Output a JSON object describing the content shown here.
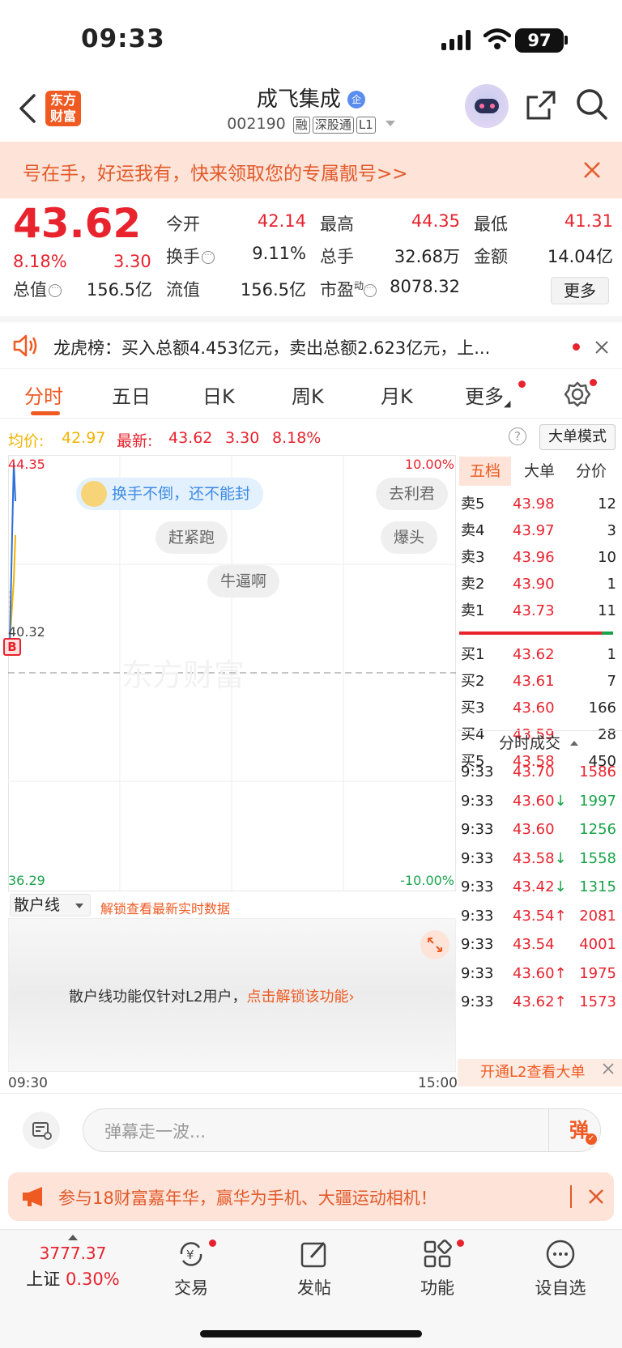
{
  "status_bar": {
    "time": "09:33",
    "battery": "97"
  },
  "header": {
    "logo_line1": "东方",
    "logo_line2": "财富",
    "stock_name": "成飞集成",
    "stock_badge": "企",
    "stock_code": "002190",
    "tags": [
      "融",
      "深股通",
      "L1"
    ]
  },
  "promo": {
    "text": "号在手，好运我有，快来领取您的专属靓号>>"
  },
  "quote": {
    "price": "43.62",
    "change_pct": "8.18%",
    "change": "3.30",
    "fields": [
      {
        "label": "今开",
        "value": "42.14",
        "color": "red"
      },
      {
        "label": "最高",
        "value": "44.35",
        "color": "red"
      },
      {
        "label": "最低",
        "value": "41.31",
        "color": "red"
      },
      {
        "label": "换手",
        "value": "9.11%",
        "color": "dark"
      },
      {
        "label": "总手",
        "value": "32.68万",
        "color": "dark"
      },
      {
        "label": "金额",
        "value": "14.04亿",
        "color": "dark"
      },
      {
        "label": "总值",
        "value": "156.5亿",
        "color": "dark"
      },
      {
        "label": "流值",
        "value": "156.5亿",
        "color": "dark"
      },
      {
        "label": "市盈",
        "value": "8078.32",
        "color": "dark"
      }
    ],
    "pe_superscript": "动",
    "more_label": "更多"
  },
  "dragon_tiger": {
    "text": "龙虎榜：买入总额4.453亿元，卖出总额2.623亿元，上..."
  },
  "tabs": [
    "分时",
    "五日",
    "日K",
    "周K",
    "月K",
    "更多"
  ],
  "info_line": {
    "avg_label": "均价:",
    "avg_value": "42.97",
    "latest_label": "最新:",
    "latest_value": "43.62",
    "change": "3.30",
    "change_pct": "8.18%",
    "big_order_mode": "大单模式"
  },
  "chart_data": {
    "type": "line",
    "y_high": "44.35",
    "y_low": "36.29",
    "y_prev_close": "40.32",
    "pct_high": "10.00%",
    "pct_low": "-10.00%",
    "x_start": "09:30",
    "x_end": "15:00",
    "watermark": "东方财富",
    "series": [
      {
        "values": [
          40.9,
          44.35,
          43.62
        ]
      },
      {
        "values": [
          40.9,
          42.1,
          42.97
        ]
      }
    ],
    "buy_marker": "B"
  },
  "danmaku": [
    "换手不倒，还不能封",
    "去利君",
    "赶紧跑",
    "爆头",
    "牛逼啊"
  ],
  "order_book": {
    "tabs": [
      "五档",
      "大单",
      "分价"
    ],
    "sells": [
      {
        "label": "卖5",
        "price": "43.98",
        "vol": "12"
      },
      {
        "label": "卖4",
        "price": "43.97",
        "vol": "3"
      },
      {
        "label": "卖3",
        "price": "43.96",
        "vol": "10"
      },
      {
        "label": "卖2",
        "price": "43.90",
        "vol": "1"
      },
      {
        "label": "卖1",
        "price": "43.73",
        "vol": "11"
      }
    ],
    "buys": [
      {
        "label": "买1",
        "price": "43.62",
        "vol": "1"
      },
      {
        "label": "买2",
        "price": "43.61",
        "vol": "7"
      },
      {
        "label": "买3",
        "price": "43.60",
        "vol": "166"
      },
      {
        "label": "买4",
        "price": "43.59",
        "vol": "28"
      },
      {
        "label": "买5",
        "price": "43.58",
        "vol": "450"
      }
    ],
    "ticks_title": "分时成交",
    "ticks": [
      {
        "time": "9:33",
        "price": "43.70",
        "arrow": "",
        "vol": "1586",
        "color": "red"
      },
      {
        "time": "9:33",
        "price": "43.60",
        "arrow": "↓",
        "vol": "1997",
        "color": "green"
      },
      {
        "time": "9:33",
        "price": "43.60",
        "arrow": "",
        "vol": "1256",
        "color": "green"
      },
      {
        "time": "9:33",
        "price": "43.58",
        "arrow": "↓",
        "vol": "1558",
        "color": "green"
      },
      {
        "time": "9:33",
        "price": "43.42",
        "arrow": "↓",
        "vol": "1315",
        "color": "green"
      },
      {
        "time": "9:33",
        "price": "43.54",
        "arrow": "↑",
        "vol": "2081",
        "color": "red"
      },
      {
        "time": "9:33",
        "price": "43.54",
        "arrow": "",
        "vol": "4001",
        "color": "red"
      },
      {
        "time": "9:33",
        "price": "43.60",
        "arrow": "↑",
        "vol": "1975",
        "color": "red"
      },
      {
        "time": "9:33",
        "price": "43.62",
        "arrow": "↑",
        "vol": "1573",
        "color": "red"
      }
    ],
    "l2_promo": "开通L2查看大单"
  },
  "retail_line": {
    "select_label": "散户线",
    "unlock_hint": "解锁查看最新实时数据",
    "panel_text": "散户线功能仅针对L2用户，",
    "panel_link": "点击解锁该功能"
  },
  "danmu_input": {
    "placeholder": "弹幕走一波...",
    "send_label": "弹"
  },
  "activity": {
    "text": "参与18财富嘉年华，赢华为手机、大疆运动相机！"
  },
  "bottom_nav": {
    "index_value": "3777.37",
    "index_name": "上证",
    "index_pct": "0.30%",
    "items": [
      "交易",
      "发帖",
      "功能",
      "设自选"
    ]
  },
  "colors": {
    "up": "#e8232e",
    "down": "#1aa34a",
    "accent": "#ef5a22",
    "avg_line": "#f0b400",
    "price_line": "#2f6fd6"
  }
}
